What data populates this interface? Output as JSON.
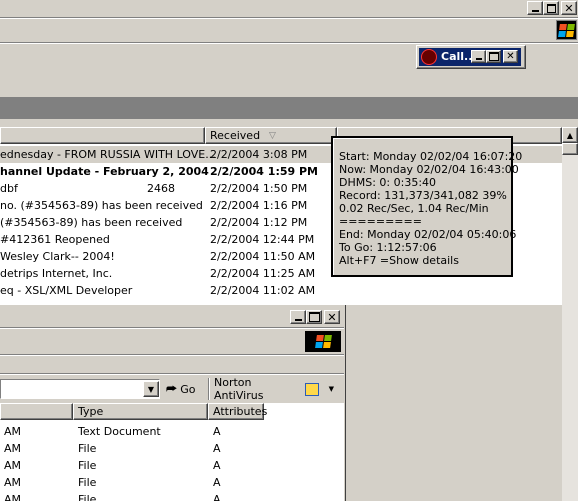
{
  "outlook": {
    "column_received": "Received",
    "rows": [
      {
        "subject": "ednesday - FROM RUSSIA WITH LOVE...",
        "size": "",
        "received": "2/2/2004 3:08 PM",
        "bold": false,
        "selected": true
      },
      {
        "subject": "hannel Update - February 2, 2004",
        "size": "",
        "received": "2/2/2004 1:59 PM",
        "bold": true,
        "selected": false
      },
      {
        "subject": "dbf",
        "size": "2468",
        "received": "2/2/2004 1:50 PM",
        "bold": false,
        "selected": false
      },
      {
        "subject": " no. (#354563-89) has been received",
        "size": "",
        "received": "2/2/2004 1:16 PM",
        "bold": false,
        "selected": false
      },
      {
        "subject": " (#354563-89) has been received",
        "size": "",
        "received": "2/2/2004 1:12 PM",
        "bold": false,
        "selected": false
      },
      {
        "subject": " #412361 Reopened",
        "size": "",
        "received": "2/2/2004 12:44 PM",
        "bold": false,
        "selected": false
      },
      {
        "subject": "Wesley Clark-- 2004!",
        "size": "",
        "received": "2/2/2004 11:50 AM",
        "bold": false,
        "selected": false
      },
      {
        "subject": "detrips Internet, Inc.",
        "size": "",
        "received": "2/2/2004 11:25 AM",
        "bold": false,
        "selected": false
      },
      {
        "subject": "eq  - XSL/XML Developer",
        "size": "",
        "received": "2/2/2004 11:02 AM",
        "bold": false,
        "selected": false
      }
    ]
  },
  "mini_window": {
    "title": "Call..."
  },
  "tooltip": {
    "lines": [
      "Start: Monday 02/02/04 16:07:20",
      "Now: Monday 02/02/04 16:43:00",
      "DHMS:  0: 0:35:40",
      "Record: 131,373/341,082 39%",
      "0.02 Rec/Sec, 1.04 Rec/Min",
      "=========",
      "End:  Monday 02/02/04 05:40:06",
      "To Go:  1:12:57:06",
      "Alt+F7 =Show details"
    ]
  },
  "explorer": {
    "go_label": "Go",
    "norton_label": "Norton AntiVirus",
    "columns": [
      "Type",
      "Attributes"
    ],
    "rows": [
      {
        "modified": "AM",
        "type": "Text Document",
        "attr": "A"
      },
      {
        "modified": "AM",
        "type": "File",
        "attr": "A"
      },
      {
        "modified": "AM",
        "type": "File",
        "attr": "A"
      },
      {
        "modified": "AM",
        "type": "File",
        "attr": "A"
      },
      {
        "modified": "AM",
        "type": "File",
        "attr": "A"
      }
    ]
  },
  "colors": {
    "selection": "#d4d0c8",
    "pane_white": "#ffffff",
    "band_gray": "#808080"
  }
}
